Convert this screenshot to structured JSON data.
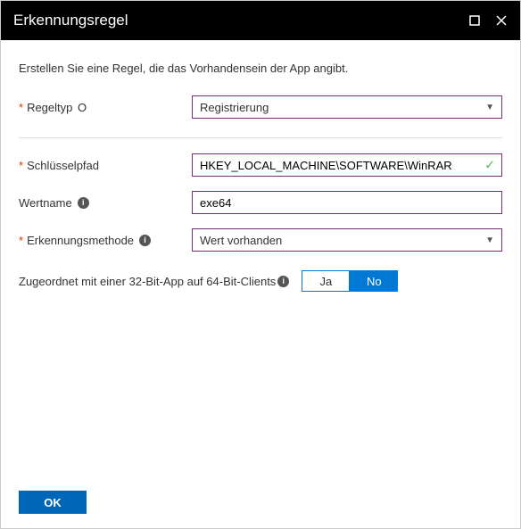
{
  "header": {
    "title": "Erkennungsregel"
  },
  "description": "Erstellen Sie eine Regel, die das Vorhandensein der App angibt.",
  "fields": {
    "ruleType": {
      "label": "Regeltyp",
      "value": "Registrierung"
    },
    "keyPath": {
      "label": "Schlüsselpfad",
      "value": "HKEY_LOCAL_MACHINE\\SOFTWARE\\WinRAR"
    },
    "valueName": {
      "label": "Wertname",
      "value": "exe64"
    },
    "detectionMethod": {
      "label": "Erkennungsmethode",
      "value": "Wert vorhanden"
    },
    "associate32": {
      "label": "Zugeordnet mit einer 32-Bit-App auf 64-Bit-Clients",
      "yes": "Ja",
      "no": "No",
      "selected": "no"
    }
  },
  "footer": {
    "okLabel": "OK"
  }
}
